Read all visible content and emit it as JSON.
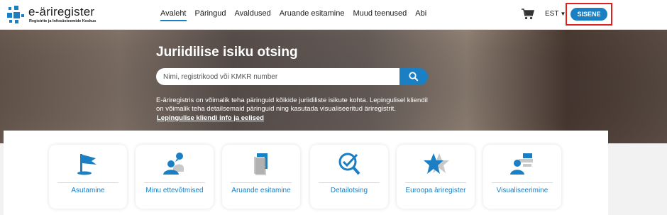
{
  "logo": {
    "name": "e-äriregister",
    "subtitle": "Registrite ja Infosüsteemide Keskus"
  },
  "nav": {
    "items": [
      {
        "label": "Avaleht",
        "active": true
      },
      {
        "label": "Päringud",
        "active": false
      },
      {
        "label": "Avaldused",
        "active": false
      },
      {
        "label": "Aruande esitamine",
        "active": false
      },
      {
        "label": "Muud teenused",
        "active": false
      },
      {
        "label": "Abi",
        "active": false
      }
    ]
  },
  "header": {
    "cart_icon": "shopping-cart-icon",
    "language": "EST",
    "login_label": "SISENE"
  },
  "hero": {
    "title": "Juriidilise isiku otsing",
    "search_placeholder": "Nimi, registrikood või KMKR number",
    "description": "E-äriregistris on võimalik teha päringuid kõikide juriidiliste isikute kohta. Lepingulisel kliendil on võimalik teha detailsemaid päringuid ning kasutada visualiseeritud äriregistrit.",
    "link": "Lepingulise kliendi info ja eelised"
  },
  "tiles": [
    {
      "label": "Asutamine",
      "icon": "flag-icon"
    },
    {
      "label": "Minu ettevõtmised",
      "icon": "user-chat-icon"
    },
    {
      "label": "Aruande esitamine",
      "icon": "documents-icon"
    },
    {
      "label": "Detailotsing",
      "icon": "magnifier-check-icon"
    },
    {
      "label": "Euroopa äriregister",
      "icon": "star-icon"
    },
    {
      "label": "Visualiseerimine",
      "icon": "user-chart-icon"
    }
  ],
  "colors": {
    "accent": "#1b7fc4",
    "highlight_border": "#e0201f"
  }
}
